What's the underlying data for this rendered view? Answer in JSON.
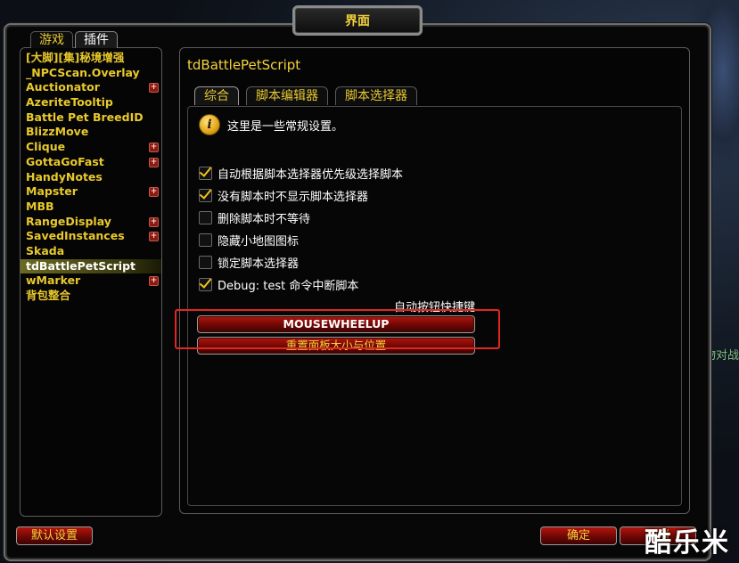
{
  "window": {
    "title": "界面"
  },
  "category_tabs": [
    {
      "label": "游戏",
      "active": false
    },
    {
      "label": "插件",
      "active": true
    }
  ],
  "addons": [
    {
      "label": "[大脚][集]秘境增强",
      "expand": false,
      "selected": false
    },
    {
      "label": "_NPCScan.Overlay",
      "expand": false,
      "selected": false
    },
    {
      "label": "Auctionator",
      "expand": true,
      "selected": false
    },
    {
      "label": "AzeriteTooltip",
      "expand": false,
      "selected": false
    },
    {
      "label": "Battle Pet BreedID",
      "expand": false,
      "selected": false
    },
    {
      "label": "BlizzMove",
      "expand": false,
      "selected": false
    },
    {
      "label": "Clique",
      "expand": true,
      "selected": false
    },
    {
      "label": "GottaGoFast",
      "expand": true,
      "selected": false
    },
    {
      "label": "HandyNotes",
      "expand": false,
      "selected": false
    },
    {
      "label": "Mapster",
      "expand": true,
      "selected": false
    },
    {
      "label": "MBB",
      "expand": false,
      "selected": false
    },
    {
      "label": "RangeDisplay",
      "expand": true,
      "selected": false
    },
    {
      "label": "SavedInstances",
      "expand": true,
      "selected": false
    },
    {
      "label": "Skada",
      "expand": false,
      "selected": false
    },
    {
      "label": "tdBattlePetScript",
      "expand": false,
      "selected": true
    },
    {
      "label": "wMarker",
      "expand": true,
      "selected": false
    },
    {
      "label": "背包整合",
      "expand": false,
      "selected": false
    }
  ],
  "panel": {
    "title": "tdBattlePetScript",
    "tabs": [
      {
        "label": "综合",
        "active": true
      },
      {
        "label": "脚本编辑器",
        "active": false
      },
      {
        "label": "脚本选择器",
        "active": false
      }
    ],
    "info_text": "这里是一些常规设置。",
    "options": [
      {
        "label": "自动根据脚本选择器优先级选择脚本",
        "checked": true
      },
      {
        "label": "没有脚本时不显示脚本选择器",
        "checked": true
      },
      {
        "label": "删除脚本时不等待",
        "checked": false
      },
      {
        "label": "隐藏小地图图标",
        "checked": false
      },
      {
        "label": "锁定脚本选择器",
        "checked": false
      },
      {
        "label": "Debug: test 命令中断脚本",
        "checked": true
      }
    ],
    "keybind_label": "自动按钮快捷键",
    "keybind_button": "MOUSEWHEELUP",
    "reset_button": "重置面板大小与位置"
  },
  "bottom": {
    "defaults_button": "默认设置",
    "ok_button": "确定",
    "cancel_button": "取消"
  },
  "background_text": "宠物对战",
  "watermark": "酷乐米",
  "icons": {
    "expand": "plus-icon",
    "info": "info-icon",
    "check": "checkmark-icon"
  }
}
